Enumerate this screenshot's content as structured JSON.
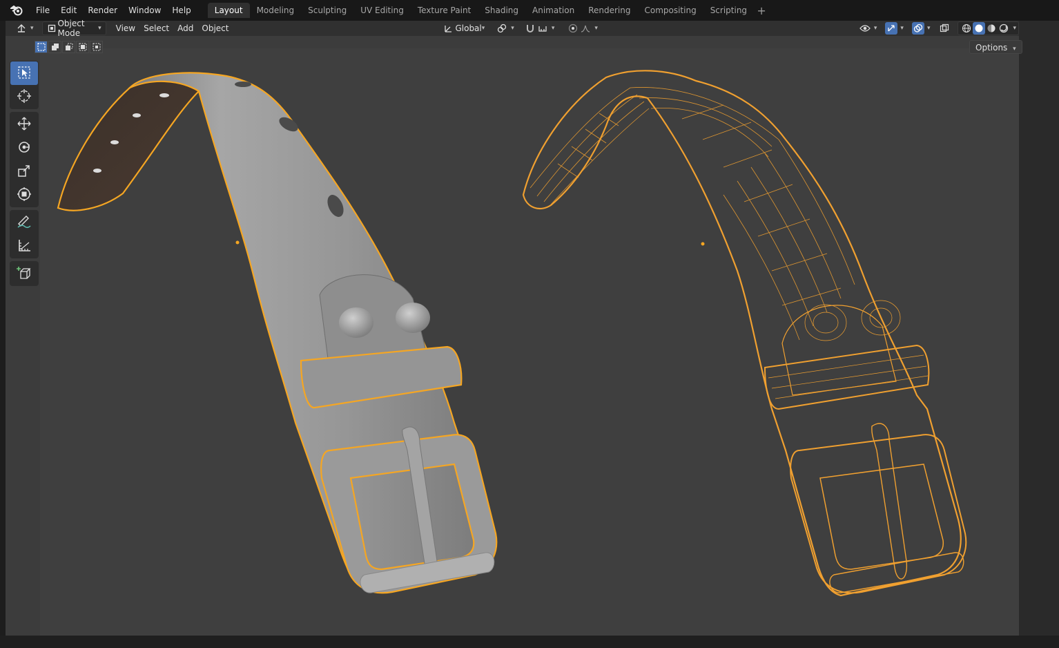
{
  "menu": {
    "items": [
      "File",
      "Edit",
      "Render",
      "Window",
      "Help"
    ]
  },
  "workspaces": {
    "tabs": [
      "Layout",
      "Modeling",
      "Sculpting",
      "UV Editing",
      "Texture Paint",
      "Shading",
      "Animation",
      "Rendering",
      "Compositing",
      "Scripting"
    ],
    "active": "Layout"
  },
  "header": {
    "mode": "Object Mode",
    "menus": [
      "View",
      "Select",
      "Add",
      "Object"
    ],
    "orientation": "Global",
    "options": "Options"
  },
  "toolbar": {
    "tools": [
      "select-box-icon",
      "cursor-icon",
      "move-icon",
      "rotate-icon",
      "scale-icon",
      "transform-icon",
      "annotate-icon",
      "measure-icon",
      "add-cube-icon"
    ],
    "active": "select-box-icon"
  },
  "colors": {
    "accent": "#4772b3",
    "selection_outline": "#f5a623",
    "wire": "#f0a030",
    "viewport_bg": "#3c3c3c"
  }
}
